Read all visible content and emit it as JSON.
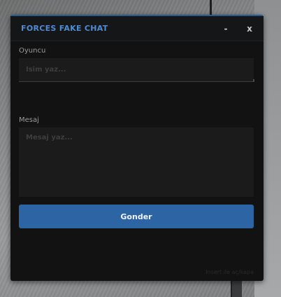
{
  "window": {
    "title": "FORCES FAKE CHAT",
    "minimize_label": "-",
    "close_label": "x"
  },
  "player": {
    "label": "Oyuncu",
    "placeholder": "İsim yaz...",
    "value": ""
  },
  "message": {
    "label": "Mesaj",
    "placeholder": "Mesaj yaz...",
    "value": ""
  },
  "send_button": {
    "label": "Gonder"
  },
  "hint": "Insert ile aç/kapa",
  "colors": {
    "accent": "#4f8bd3",
    "button": "#2d64a4",
    "panel_bg": "#121212",
    "input_bg": "#1b1b1b"
  }
}
